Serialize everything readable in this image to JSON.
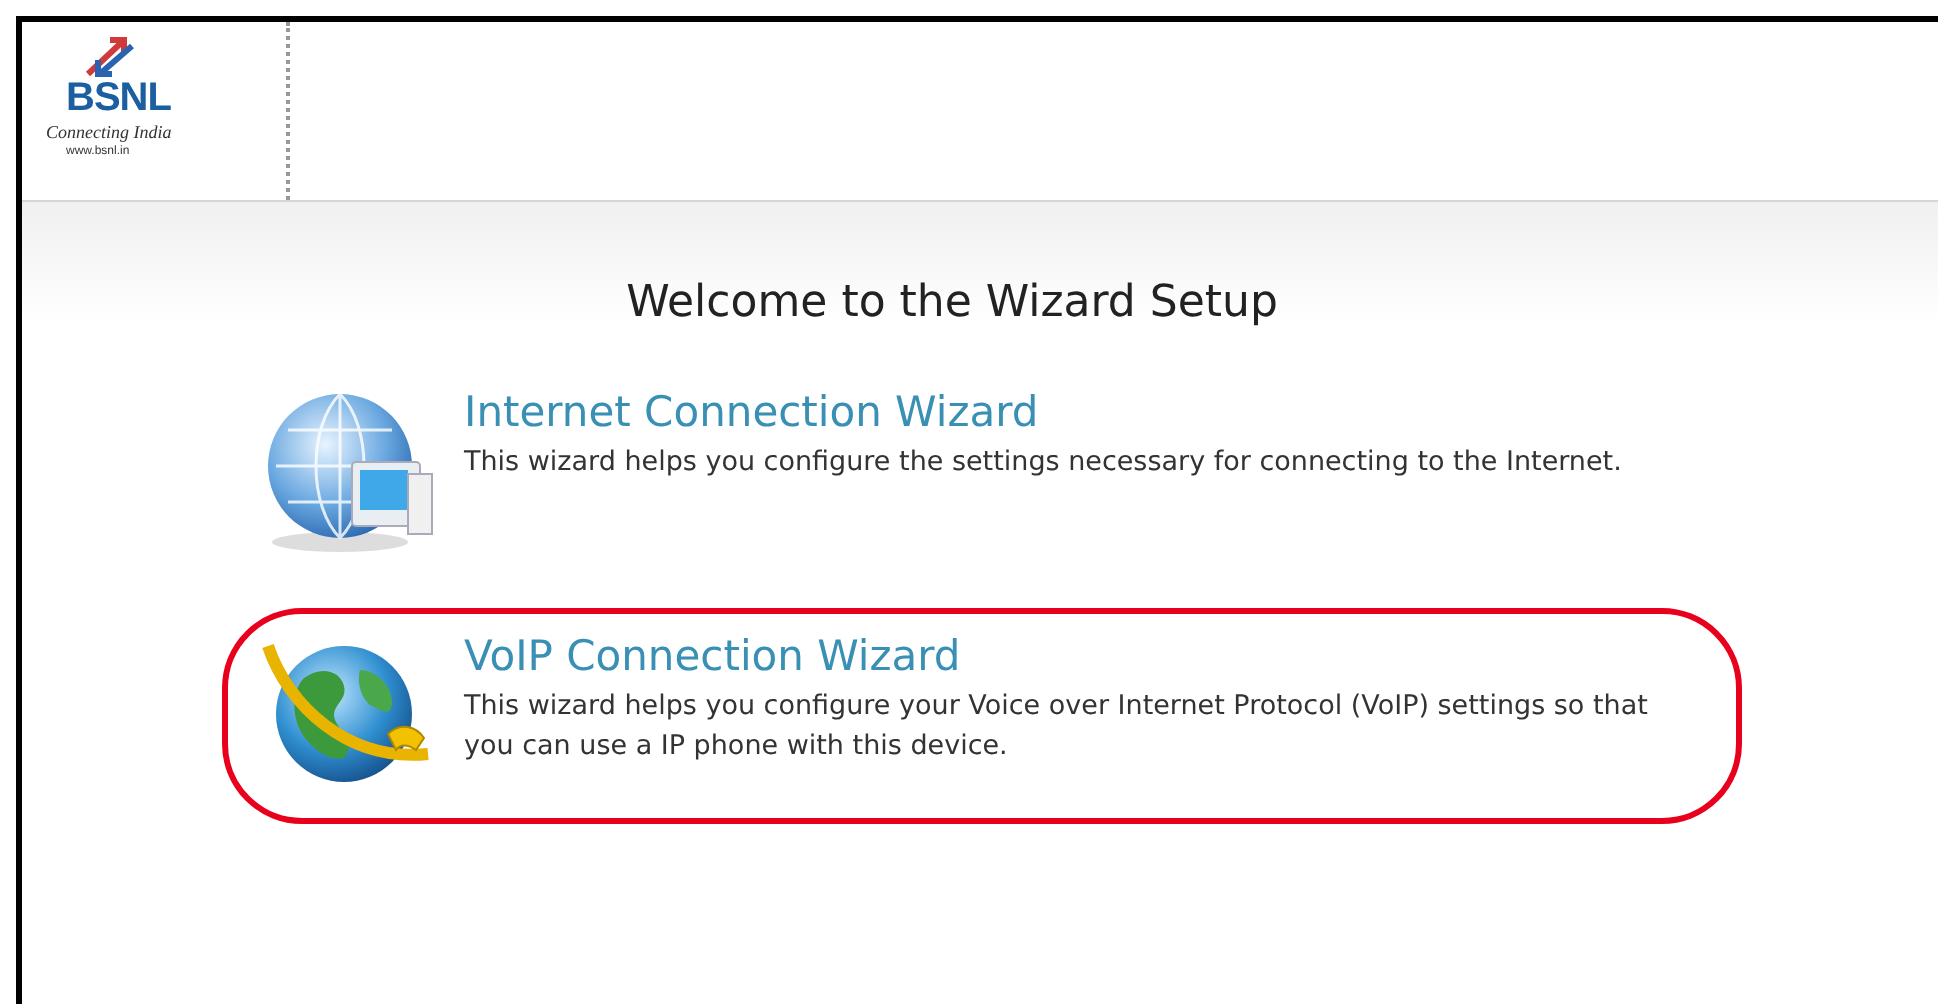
{
  "logo": {
    "name": "BSNL",
    "tagline": "Connecting India",
    "url": "www.bsnl.in"
  },
  "heading": "Welcome to the Wizard Setup",
  "wizards": [
    {
      "kind": "internet",
      "title": "Internet Connection Wizard",
      "description": "This wizard helps you configure the settings necessary for connecting to the Internet.",
      "highlighted": false
    },
    {
      "kind": "voip",
      "title": "VoIP Connection Wizard",
      "description": "This wizard helps you configure your Voice over Internet Protocol (VoIP) settings so that you can use a IP phone with this device.",
      "highlighted": true
    }
  ]
}
